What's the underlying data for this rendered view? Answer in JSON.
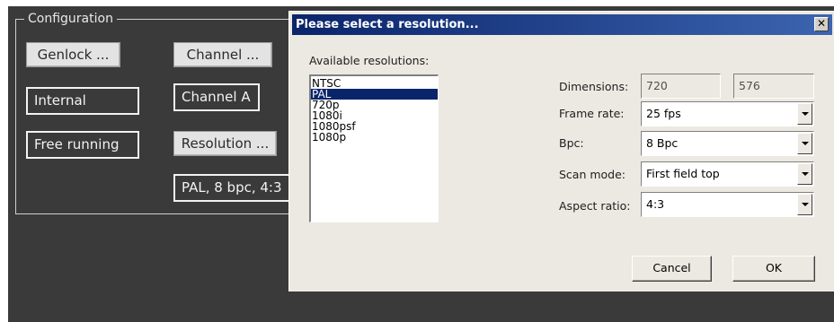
{
  "configuration": {
    "group_title": "Configuration",
    "genlock_button": "Genlock ...",
    "channel_button": "Channel ...",
    "genlock_value": "Internal",
    "channel_value": "Channel A",
    "sync_value": "Free running",
    "resolution_button": "Resolution ...",
    "resolution_value": "PAL, 8 bpc, 4:3"
  },
  "dialog": {
    "title": "Please select a resolution...",
    "close_glyph": "✕",
    "available_label": "Available resolutions:",
    "resolutions": [
      "NTSC",
      "PAL",
      "720p",
      "1080i",
      "1080psf",
      "1080p"
    ],
    "selected_resolution": "PAL",
    "dimensions_label": "Dimensions:",
    "width": "720",
    "height": "576",
    "frame_rate_label": "Frame rate:",
    "frame_rate": "25 fps",
    "bpc_label": "Bpc:",
    "bpc": "8 Bpc",
    "scan_mode_label": "Scan mode:",
    "scan_mode": "First field top",
    "aspect_ratio_label": "Aspect ratio:",
    "aspect_ratio": "4:3",
    "cancel_label": "Cancel",
    "ok_label": "OK"
  },
  "colors": {
    "title_bar": "#0a246a",
    "selection": "#0a246a",
    "dialog_bg": "#ece9e2",
    "app_bg": "#3a3a3a"
  }
}
